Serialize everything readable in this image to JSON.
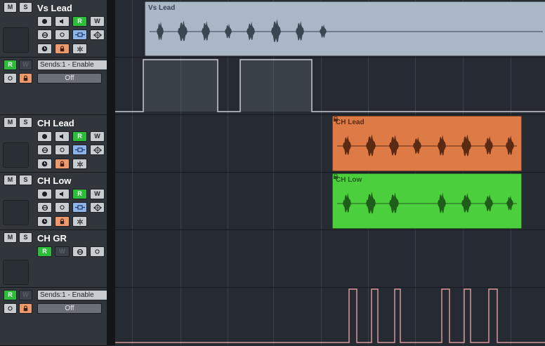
{
  "tracks": [
    {
      "name": "Vs Lead",
      "mute": "M",
      "solo": "S",
      "read": "R",
      "write": "W"
    },
    {
      "automation": {
        "read": "R",
        "write": "W",
        "param": "Sends:1 - Enable",
        "value": "Off"
      }
    },
    {
      "name": "CH Lead",
      "mute": "M",
      "solo": "S",
      "read": "R",
      "write": "W"
    },
    {
      "name": "CH Low",
      "mute": "M",
      "solo": "S",
      "read": "R",
      "write": "W"
    },
    {
      "name": "CH GR",
      "mute": "M",
      "solo": "S",
      "read": "R",
      "write": "W"
    },
    {
      "automation": {
        "read": "R",
        "write": "W",
        "param": "Sends:1 - Enable",
        "value": "Off"
      }
    }
  ],
  "events": [
    {
      "label": "Vs Lead",
      "color": "#a9b7c7",
      "wave": "#3b4653"
    },
    {
      "label": "CH Lead",
      "color": "#de7a46",
      "wave": "#5a2a13"
    },
    {
      "label": "CH Low",
      "color": "#4ccf3c",
      "wave": "#1f5e1a"
    }
  ],
  "colors": {
    "accent_green": "#2ebd3b",
    "accent_orange": "#ec9a6c",
    "accent_blue": "#8fb4e8",
    "automation_line_1": "#c9ccd1",
    "automation_line_2": "#d99797"
  },
  "icons": [
    "record-icon",
    "monitor-icon",
    "edit-icon",
    "lane-icon",
    "inserts-icon",
    "freeze-icon",
    "timebase-icon",
    "lock-icon",
    "snowflake-icon"
  ]
}
